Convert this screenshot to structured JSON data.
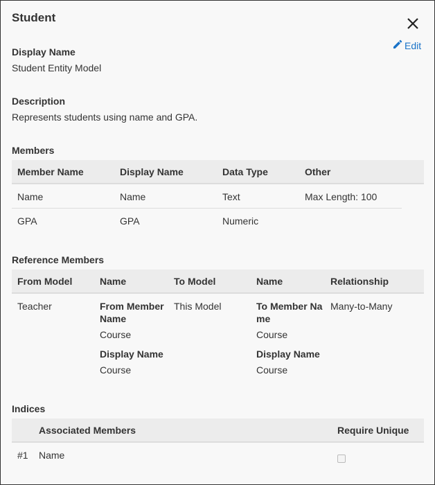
{
  "dialog": {
    "title": "Student",
    "edit_label": "Edit"
  },
  "display_name": {
    "label": "Display Name",
    "value": "Student Entity Model"
  },
  "description": {
    "label": "Description",
    "value": "Represents students using name and GPA."
  },
  "members": {
    "label": "Members",
    "headers": [
      "Member Name",
      "Display Name",
      "Data Type",
      "Other"
    ],
    "rows": [
      [
        "Name",
        "Name",
        "Text",
        "Max Length: 100"
      ],
      [
        "GPA",
        "GPA",
        "Numeric",
        ""
      ]
    ]
  },
  "reference_members": {
    "label": "Reference Members",
    "headers": [
      "From Model",
      "Name",
      "To Model",
      "Name",
      "Relationship"
    ],
    "row": {
      "from_model": "Teacher",
      "from_member_name_label_1": "From Member",
      "from_member_name_label_2": "Name",
      "from_member_name_value": "Course",
      "from_display_name_label": "Display Name",
      "from_display_name_value": "Course",
      "to_model": "This Model",
      "to_member_name_label_1": "To Member Na",
      "to_member_name_label_2": "me",
      "to_member_name_value": "Course",
      "to_display_name_label": "Display Name",
      "to_display_name_value": "Course",
      "relationship": "Many-to-Many"
    }
  },
  "indices": {
    "label": "Indices",
    "headers": [
      "Associated Members",
      "Require Unique"
    ],
    "rows": [
      {
        "index": "#1",
        "members": "Name",
        "require_unique": false
      }
    ]
  }
}
